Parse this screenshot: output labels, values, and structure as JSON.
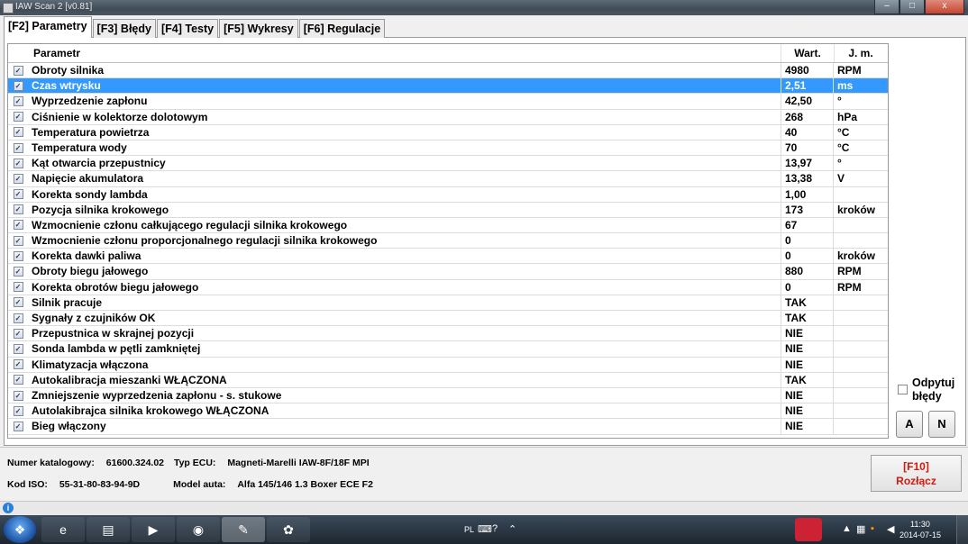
{
  "window": {
    "title": "IAW Scan 2 [v0.81]",
    "minimize": "–",
    "maximize": "□",
    "close": "x"
  },
  "tabs": [
    {
      "label": "[F2] Parametry",
      "active": true
    },
    {
      "label": "[F3] Błędy",
      "active": false
    },
    {
      "label": "[F4] Testy",
      "active": false
    },
    {
      "label": "[F5] Wykresy",
      "active": false
    },
    {
      "label": "[F6] Regulacje",
      "active": false
    }
  ],
  "grid": {
    "headers": {
      "parameter": "Parametr",
      "value": "Wart.",
      "unit": "J. m."
    },
    "rows": [
      {
        "name": "Obroty silnika",
        "value": "4980",
        "unit": "RPM",
        "checked": true,
        "selected": false
      },
      {
        "name": "Czas wtrysku",
        "value": "2,51",
        "unit": "ms",
        "checked": true,
        "selected": true
      },
      {
        "name": "Wyprzedzenie zapłonu",
        "value": "42,50",
        "unit": "°",
        "checked": true,
        "selected": false
      },
      {
        "name": "Ciśnienie w kolektorze dolotowym",
        "value": "268",
        "unit": "hPa",
        "checked": true,
        "selected": false
      },
      {
        "name": "Temperatura powietrza",
        "value": "40",
        "unit": "°C",
        "checked": true,
        "selected": false
      },
      {
        "name": "Temperatura wody",
        "value": "70",
        "unit": "°C",
        "checked": true,
        "selected": false
      },
      {
        "name": "Kąt otwarcia przepustnicy",
        "value": "13,97",
        "unit": "°",
        "checked": true,
        "selected": false
      },
      {
        "name": "Napięcie akumulatora",
        "value": "13,38",
        "unit": "V",
        "checked": true,
        "selected": false
      },
      {
        "name": "Korekta sondy lambda",
        "value": "1,00",
        "unit": "",
        "checked": true,
        "selected": false
      },
      {
        "name": "Pozycja silnika krokowego",
        "value": "173",
        "unit": "kroków",
        "checked": true,
        "selected": false
      },
      {
        "name": "Wzmocnienie członu całkującego regulacji silnika krokowego",
        "value": "67",
        "unit": "",
        "checked": true,
        "selected": false
      },
      {
        "name": "Wzmocnienie członu proporcjonalnego regulacji silnika krokowego",
        "value": "0",
        "unit": "",
        "checked": true,
        "selected": false
      },
      {
        "name": "Korekta dawki paliwa",
        "value": "0",
        "unit": "kroków",
        "checked": true,
        "selected": false
      },
      {
        "name": "Obroty biegu jałowego",
        "value": "880",
        "unit": "RPM",
        "checked": true,
        "selected": false
      },
      {
        "name": "Korekta obrotów biegu jałowego",
        "value": "0",
        "unit": "RPM",
        "checked": true,
        "selected": false
      },
      {
        "name": "Silnik pracuje",
        "value": "TAK",
        "unit": "",
        "checked": true,
        "selected": false
      },
      {
        "name": "Sygnały z czujników OK",
        "value": "TAK",
        "unit": "",
        "checked": true,
        "selected": false
      },
      {
        "name": "Przepustnica w skrajnej pozycji",
        "value": "NIE",
        "unit": "",
        "checked": true,
        "selected": false
      },
      {
        "name": "Sonda lambda w pętli zamkniętej",
        "value": "NIE",
        "unit": "",
        "checked": true,
        "selected": false
      },
      {
        "name": "Klimatyzacja włączona",
        "value": "NIE",
        "unit": "",
        "checked": true,
        "selected": false
      },
      {
        "name": "Autokalibracja mieszanki WŁĄCZONA",
        "value": "TAK",
        "unit": "",
        "checked": true,
        "selected": false
      },
      {
        "name": "Zmniejszenie wyprzedzenia zapłonu - s. stukowe",
        "value": "NIE",
        "unit": "",
        "checked": true,
        "selected": false
      },
      {
        "name": "Autolakibrajca silnika krokowego WŁĄCZONA",
        "value": "NIE",
        "unit": "",
        "checked": true,
        "selected": false
      },
      {
        "name": "Bieg włączony",
        "value": "NIE",
        "unit": "",
        "checked": true,
        "selected": false
      }
    ]
  },
  "side": {
    "poll_errors_label_1": "Odpytuj",
    "poll_errors_label_2": "błędy",
    "poll_errors_checked": false,
    "btn_a": "A",
    "btn_n": "N"
  },
  "info": {
    "catalog_label": "Numer katalogowy:",
    "catalog_value": "61600.324.02",
    "ecu_label": "Typ ECU:",
    "ecu_value": "Magneti-Marelli IAW-8F/18F MPI",
    "iso_label": "Kod ISO:",
    "iso_value": "55-31-80-83-94-9D",
    "model_label": "Model auta:",
    "model_value": "Alfa 145/146 1.3 Boxer ECE F2"
  },
  "disconnect": {
    "key": "[F10]",
    "label": "Rozłącz"
  },
  "taskbar": {
    "language": "PL",
    "time": "11:30",
    "date": "2014-07-15"
  }
}
